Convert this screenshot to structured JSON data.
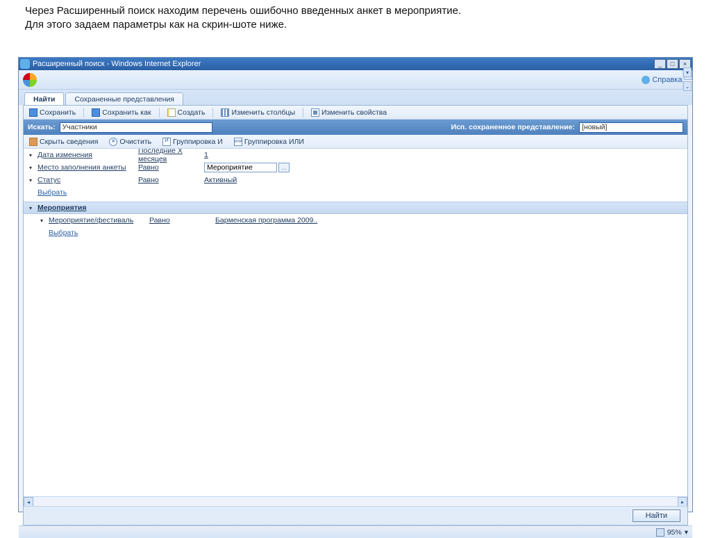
{
  "instruction": {
    "line1": "Через Расширенный поиск находим перечень ошибочно введенных анкет в мероприятие.",
    "line2": "Для этого задаем параметры как на скрин-шоте ниже."
  },
  "window": {
    "title": "Расширенный поиск - Windows Internet Explorer"
  },
  "help": {
    "label": "Справка"
  },
  "tabs": {
    "find": "Найти",
    "saved": "Сохраненные представления"
  },
  "toolbar1": {
    "save": "Сохранить",
    "saveas": "Сохранить как",
    "new": "Создать",
    "cols": "Изменить столбцы",
    "props": "Изменить свойства"
  },
  "search": {
    "label": "Искать:",
    "value": "Участники",
    "saved_label": "Исп. сохраненное представление:",
    "saved_value": "[новый]"
  },
  "toolbar2": {
    "hide": "Скрыть сведения",
    "clear": "Очистить",
    "gand": "Группировка И",
    "gor": "Группировка ИЛИ"
  },
  "criteria": {
    "row1": {
      "field": "Дата изменения",
      "op": "Последние X месяцев",
      "val": "1"
    },
    "row2": {
      "field": "Место заполнения анкеты",
      "op": "Равно",
      "val": "Мероприятие"
    },
    "row3": {
      "field": "Статус",
      "op": "Равно",
      "val": "Активный"
    },
    "select": "Выбрать",
    "group": "Мероприятия",
    "row4": {
      "field": "Мероприятие/фестиваль",
      "op": "Равно",
      "val": "Барменская программа 2009.."
    },
    "select2": "Выбрать"
  },
  "footer": {
    "find": "Найти"
  },
  "status": {
    "zoom": "95%"
  }
}
